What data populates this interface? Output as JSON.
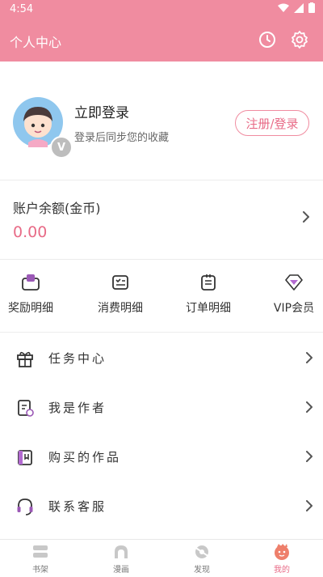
{
  "status_bar": {
    "time": "4:54"
  },
  "header": {
    "title": "个人中心"
  },
  "profile": {
    "login_title": "立即登录",
    "login_subtitle": "登录后同步您的收藏",
    "badge": "V",
    "register_button": "注册/登录"
  },
  "balance": {
    "label": "账户余额(金币)",
    "value": "0.00"
  },
  "quick_actions": [
    {
      "label": "奖励明细",
      "icon": "reward-icon"
    },
    {
      "label": "消费明细",
      "icon": "expense-icon"
    },
    {
      "label": "订单明细",
      "icon": "order-icon"
    },
    {
      "label": "VIP会员",
      "icon": "vip-diamond-icon"
    }
  ],
  "menu": [
    {
      "label": "任务中心",
      "icon": "gift-icon"
    },
    {
      "label": "我是作者",
      "icon": "author-icon"
    },
    {
      "label": "购买的作品",
      "icon": "purchased-icon"
    },
    {
      "label": "联系客服",
      "icon": "headset-icon"
    }
  ],
  "tabs": [
    {
      "label": "书架",
      "icon": "bookshelf-icon",
      "active": false
    },
    {
      "label": "漫画",
      "icon": "comic-icon",
      "active": false
    },
    {
      "label": "发现",
      "icon": "discover-icon",
      "active": false
    },
    {
      "label": "我的",
      "icon": "mine-icon",
      "active": true
    }
  ],
  "colors": {
    "brand": "#f08ca0",
    "accent": "#e86b87"
  }
}
